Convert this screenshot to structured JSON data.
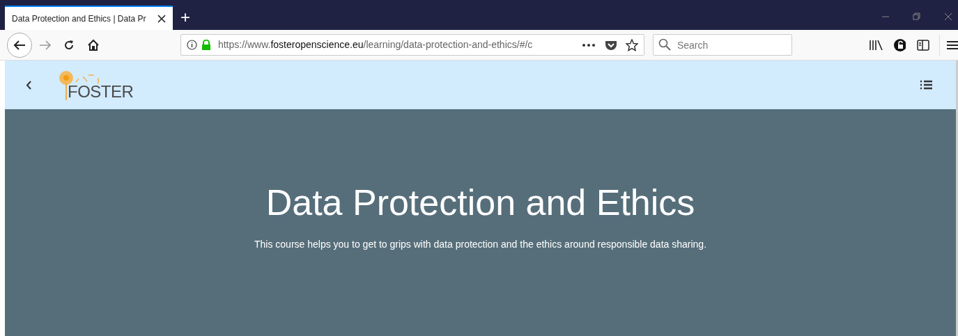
{
  "browser": {
    "tab": {
      "title": "Data Protection and Ethics | Data Pr",
      "selected": true
    },
    "new_tab": "+",
    "url": {
      "prefix": "https://www.",
      "domain": "fosteropenscience.eu",
      "path": "/learning/data-protection-and-ethics/#/c"
    },
    "search": {
      "placeholder": "Search"
    }
  },
  "site_header": {
    "logo_text": "FOSTER"
  },
  "hero": {
    "title": "Data Protection and Ethics",
    "subtitle": "This course helps you to get to grips with data protection and the ethics around responsible data sharing."
  }
}
